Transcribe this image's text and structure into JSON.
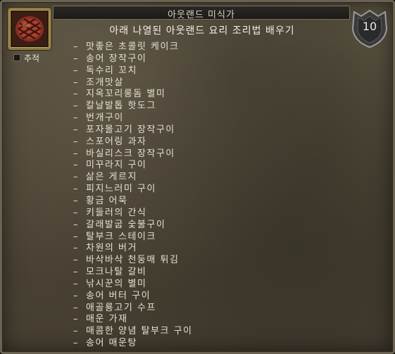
{
  "window": {
    "title": "아웃랜드 미식가",
    "badge_number": "10",
    "icon": "meat-icon"
  },
  "tracking": {
    "label": "추적",
    "checked": false
  },
  "objective": {
    "header": "아래 나열된 아웃랜드 요리 조리법 배우기",
    "bullet": "–",
    "recipes": [
      "맛좋은 초콜릿 케이크",
      "송어 장작구이",
      "독수리 꼬치",
      "조개맛살",
      "지옥꼬리롱돔 별미",
      "칼날발톱 핫도그",
      "번개구이",
      "포자몰고기 장작구이",
      "스포어링 과자",
      "바실리스크 장작구이",
      "미꾸라지 구이",
      "삶은 게르지",
      "피지느러미 구이",
      "황금 어묵",
      "키들러의 간식",
      "갈래발굽 숯불구이",
      "탈부크 스테이크",
      "차원의 버거",
      "바삭바삭 천둥매 튀김",
      "모크나탈 갈비",
      "낚시꾼의 별미",
      "송어 버터 구이",
      "애골룡고기 수프",
      "매운 가재",
      "매콤한 양념 탈부크 구이",
      "송어 매운탕"
    ]
  }
}
